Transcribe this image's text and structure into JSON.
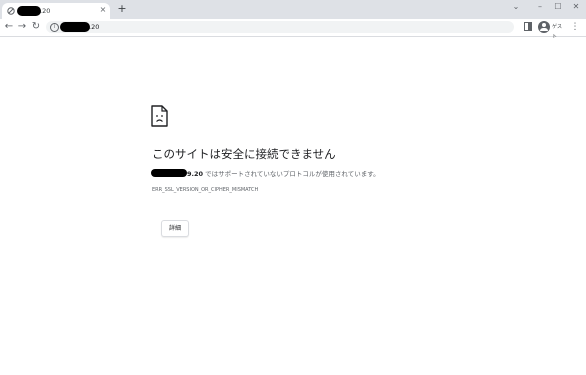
{
  "tab": {
    "title_suffix": ".20",
    "close_glyph": "×",
    "favicon": "broken-connection-icon"
  },
  "tabstrip": {
    "new_tab_glyph": "+",
    "window_controls": {
      "tab_search": "⌄",
      "minimize": "–",
      "maximize": "☐",
      "close": "✕"
    }
  },
  "toolbar": {
    "back_glyph": "←",
    "forward_glyph": "→",
    "reload_glyph": "↻",
    "url_suffix": ".20",
    "info_glyph": "i",
    "profile_label": "ゲスト",
    "menu_glyph": "⋮"
  },
  "error_page": {
    "icon": "sad-document-icon",
    "heading": "このサイトは安全に接続できません",
    "description_host_suffix": "9.20",
    "description_text": " ではサポートされていないプロトコルが使用されています。",
    "error_code": "ERR_SSL_VERSION_OR_CIPHER_MISMATCH",
    "details_button": "詳細"
  }
}
